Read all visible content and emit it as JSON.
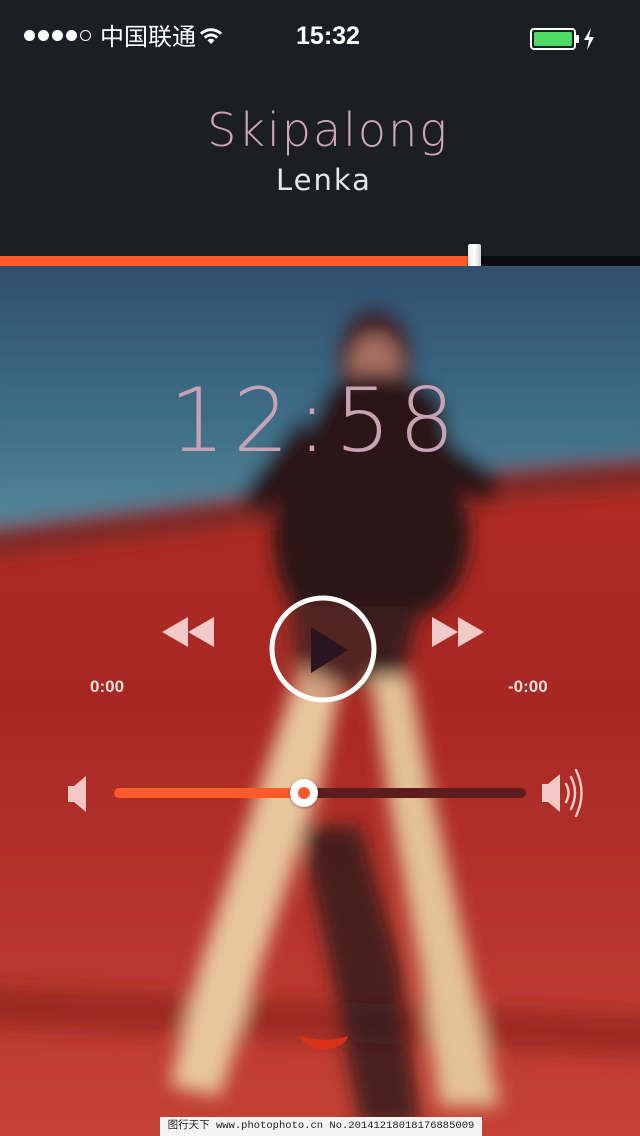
{
  "status_bar": {
    "signal_strength": 4,
    "signal_max": 5,
    "carrier": "中国联通",
    "time": "15:32",
    "battery_level": 1.0,
    "charging": true,
    "icons": [
      "wifi-icon",
      "battery-icon",
      "charging-bolt-icon"
    ]
  },
  "now_playing": {
    "title": "Skipalong",
    "artist": "Lenka"
  },
  "playback": {
    "progress": 0.74,
    "big_time": "12:58",
    "elapsed": "0:00",
    "remaining": "-0:00",
    "state": "paused"
  },
  "controls": {
    "icons": [
      "rewind-icon",
      "play-icon",
      "fast-forward-icon",
      "chevron-down-icon"
    ]
  },
  "volume": {
    "level": 0.46,
    "icons": [
      "volume-low-icon",
      "volume-high-icon"
    ]
  },
  "colors": {
    "accent": "#ff5a2a",
    "title": "#d1a6b7",
    "background": "#1b1f24"
  },
  "watermark": {
    "text": "图行天下 www.photophoto.cn No.20141218018176885009"
  }
}
